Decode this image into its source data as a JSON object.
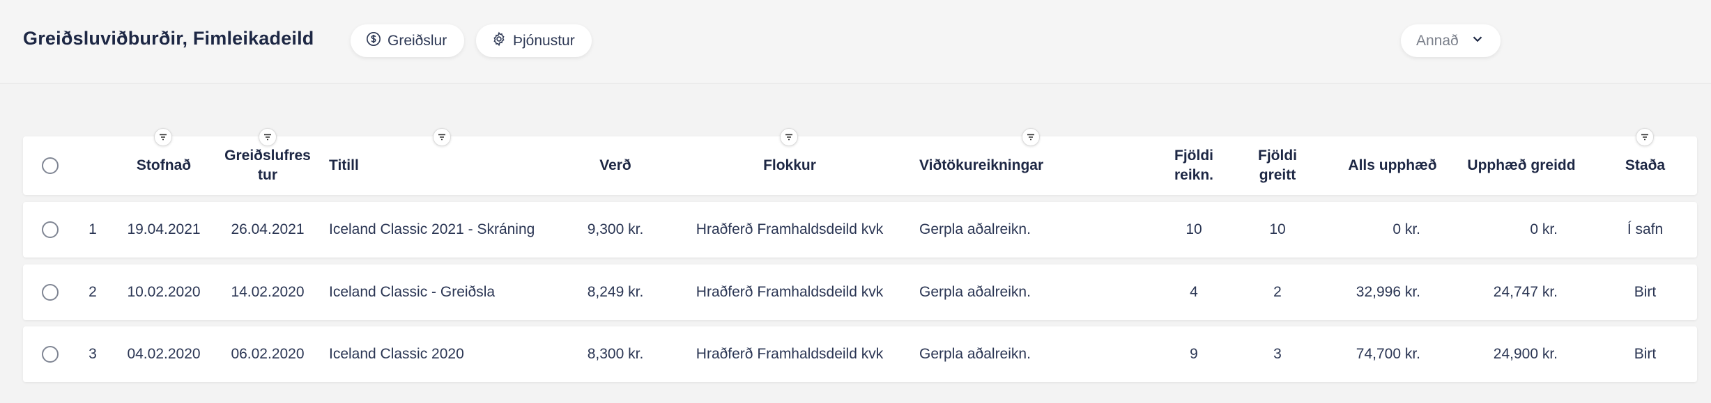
{
  "header": {
    "title": "Greiðsluviðburðir, Fimleikadeild",
    "buttons": {
      "payments": "Greiðslur",
      "services": "Þjónustur",
      "other": "Annað"
    }
  },
  "table": {
    "columns": {
      "created": "Stofnað",
      "due_date": "Greiðslufrestur",
      "due_date_line1": "Greiðslufres",
      "due_date_line2": "tur",
      "title": "Titill",
      "price": "Verð",
      "category": "Flokkur",
      "receiving_accounts": "Viðtökureikningar",
      "invoice_count_line1": "Fjöldi",
      "invoice_count_line2": "reikn.",
      "paid_count_line1": "Fjöldi",
      "paid_count_line2": "greitt",
      "total_amount": "Alls upphæð",
      "amount_paid": "Upphæð greidd",
      "status": "Staða"
    },
    "rows": [
      {
        "index": "1",
        "created": "19.04.2021",
        "due": "26.04.2021",
        "title": "Iceland Classic 2021 - Skráning",
        "price": "9,300 kr.",
        "category": "Hraðferð Framhaldsdeild kvk",
        "account": "Gerpla aðalreikn.",
        "invoices": "10",
        "paid": "10",
        "total": "0 kr.",
        "amount_paid": "0 kr.",
        "status": "Í safn"
      },
      {
        "index": "2",
        "created": "10.02.2020",
        "due": "14.02.2020",
        "title": "Iceland Classic - Greiðsla",
        "price": "8,249 kr.",
        "category": "Hraðferð Framhaldsdeild kvk",
        "account": "Gerpla aðalreikn.",
        "invoices": "4",
        "paid": "2",
        "total": "32,996 kr.",
        "amount_paid": "24,747 kr.",
        "status": "Birt"
      },
      {
        "index": "3",
        "created": "04.02.2020",
        "due": "06.02.2020",
        "title": "Iceland Classic 2020",
        "price": "8,300 kr.",
        "category": "Hraðferð Framhaldsdeild kvk",
        "account": "Gerpla aðalreikn.",
        "invoices": "9",
        "paid": "3",
        "total": "74,700 kr.",
        "amount_paid": "24,900 kr.",
        "status": "Birt"
      }
    ]
  },
  "icons": {
    "payments": "dollar-circle-icon",
    "services": "gear-icon",
    "other": "chevron-down-icon",
    "filter": "filter-icon",
    "select": "radio-circle-icon"
  }
}
